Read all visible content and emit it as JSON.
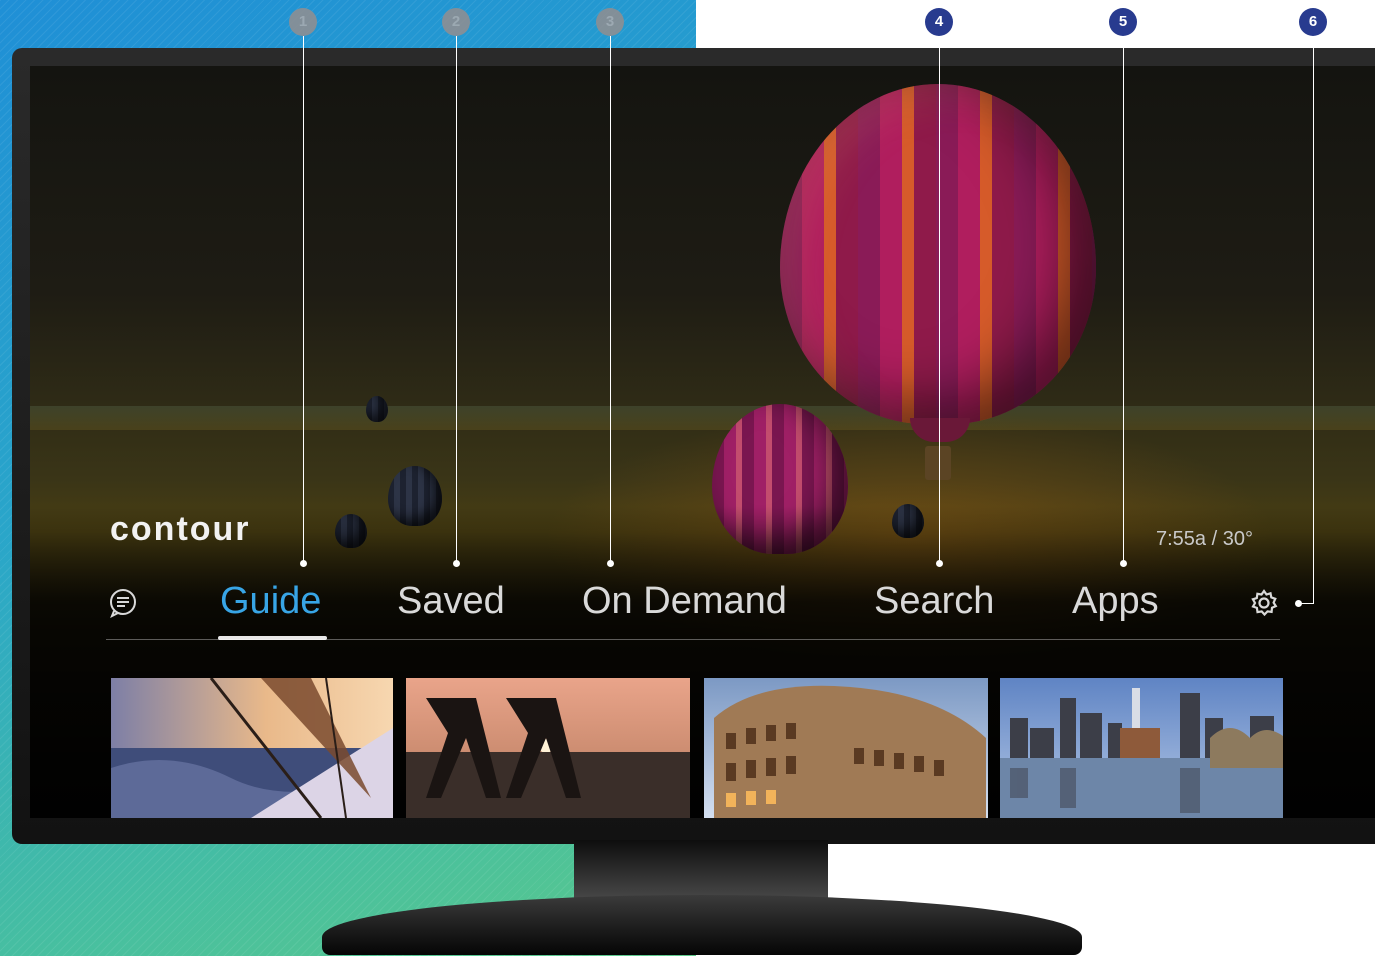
{
  "brand": {
    "logo_text": "contour"
  },
  "status": {
    "time_weather": "7:55a / 30°"
  },
  "nav": {
    "items": [
      {
        "label": "Guide",
        "active": true
      },
      {
        "label": "Saved",
        "active": false
      },
      {
        "label": "On Demand",
        "active": false
      },
      {
        "label": "Search",
        "active": false
      },
      {
        "label": "Apps",
        "active": false
      }
    ],
    "left_icon": "chat-bubble-icon",
    "right_icon": "gear-icon"
  },
  "callouts": [
    {
      "number": "1",
      "target": "Guide",
      "style": "faded"
    },
    {
      "number": "2",
      "target": "Saved",
      "style": "faded"
    },
    {
      "number": "3",
      "target": "On Demand",
      "style": "faded"
    },
    {
      "number": "4",
      "target": "Search",
      "style": "solid"
    },
    {
      "number": "5",
      "target": "Apps",
      "style": "solid"
    },
    {
      "number": "6",
      "target": "settings",
      "style": "solid"
    }
  ],
  "thumbnails": [
    {
      "scene": "sailboat-at-sunset"
    },
    {
      "scene": "couple-on-beach-chairs-at-sunset"
    },
    {
      "scene": "colosseum-rome"
    },
    {
      "scene": "city-skyline-with-river-bridge"
    }
  ],
  "colors": {
    "accent_active": "#38a5e6",
    "callout_solid": "#283b8f",
    "callout_faded": "#8d8f93",
    "backdrop_gradient_start": "#1f8fd6",
    "backdrop_gradient_end": "#5cc98a"
  }
}
